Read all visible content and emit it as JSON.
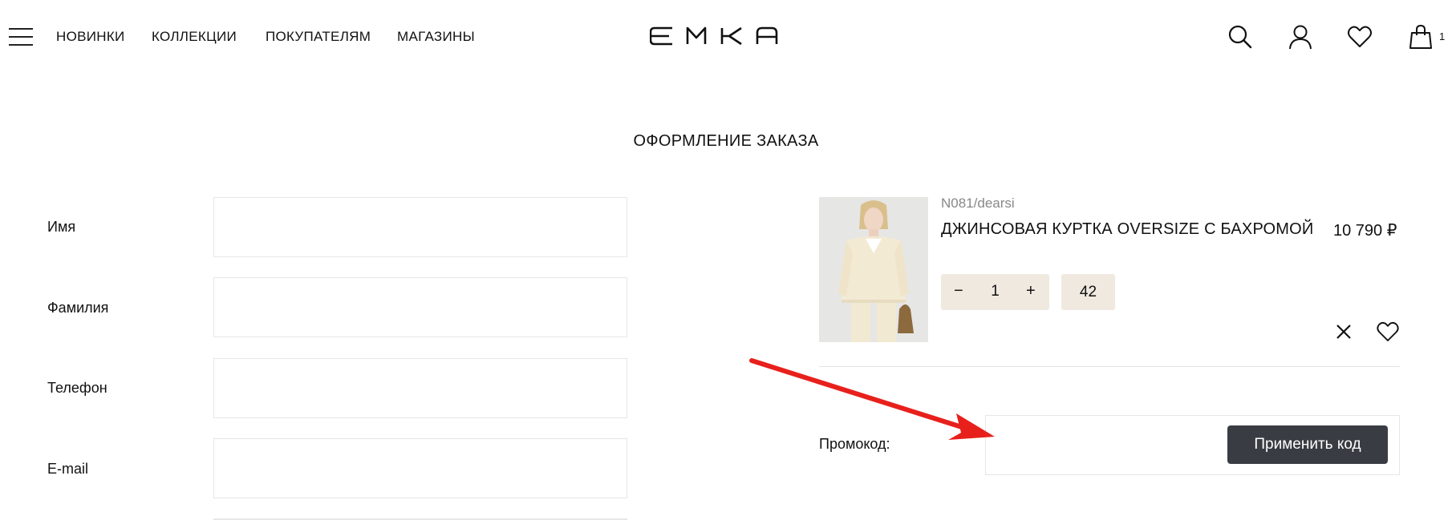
{
  "header": {
    "nav": [
      "НОВИНКИ",
      "КОЛЛЕКЦИИ",
      "ПОКУПАТЕЛЯМ",
      "МАГАЗИНЫ"
    ],
    "logo_text": "EMKA",
    "cart_count": "1",
    "icons": [
      "menu-icon",
      "search-icon",
      "user-icon",
      "heart-icon",
      "bag-icon"
    ]
  },
  "page": {
    "title": "ОФОРМЛЕНИЕ ЗАКАЗА"
  },
  "form": {
    "fields": [
      {
        "label": "Имя",
        "value": ""
      },
      {
        "label": "Фамилия",
        "value": ""
      },
      {
        "label": "Телефон",
        "value": ""
      },
      {
        "label": "E-mail",
        "value": ""
      }
    ]
  },
  "product": {
    "sku": "N081/dearsi",
    "name": "ДЖИНСОВАЯ КУРТКА OVERSIZE С БАХРОМОЙ",
    "price": "10 790 ₽",
    "quantity": "1",
    "minus": "−",
    "plus": "+",
    "size": "42"
  },
  "promo": {
    "label": "Промокод:",
    "value": "",
    "button": "Применить код"
  },
  "colors": {
    "accent_button": "#393d43",
    "chip_bg": "#efe9e0",
    "annotation_arrow": "#e8201c"
  }
}
